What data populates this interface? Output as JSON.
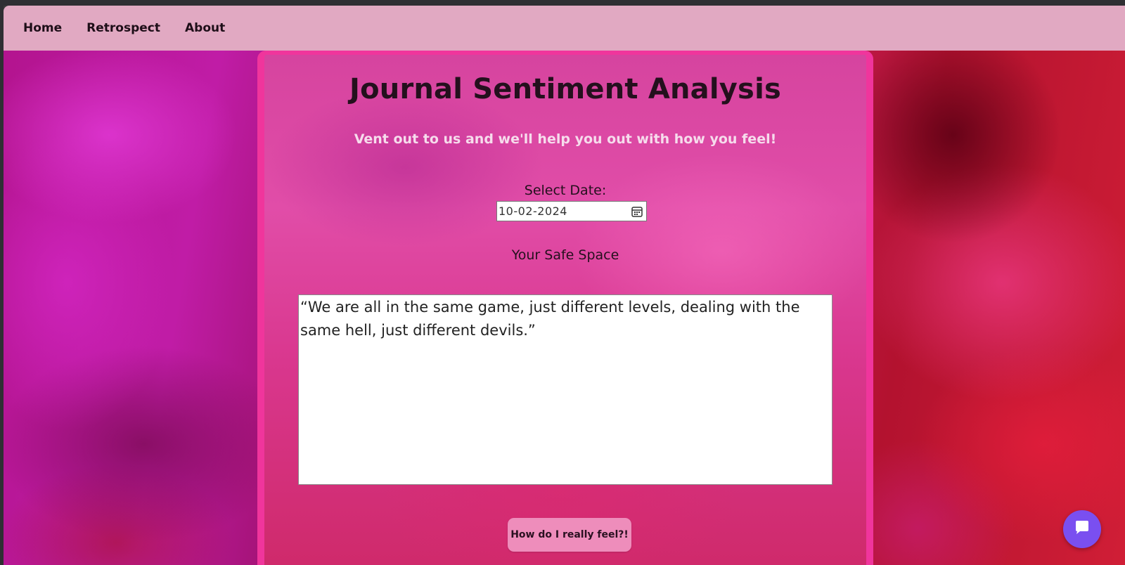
{
  "nav": {
    "items": [
      {
        "label": "Home"
      },
      {
        "label": "Retrospect"
      },
      {
        "label": "About"
      }
    ]
  },
  "main": {
    "title": "Journal Sentiment Analysis",
    "subtitle": "Vent out to us and we'll help you out with how you feel!",
    "date_label": "Select Date:",
    "date_value": "10-02-2024",
    "safe_space_label": "Your Safe Space",
    "journal_text": "“We are all in the same game, just different levels, dealing with the same hell, just different devils.”",
    "submit_label": "How do I really feel?!"
  },
  "icons": {
    "date_picker": "calendar-icon",
    "chat": "chat-icon"
  },
  "colors": {
    "navbar": "#e1a9c2",
    "card_border": "#f0359c",
    "button": "#ee8dbb",
    "chat_launcher": "#7a4ff0"
  }
}
